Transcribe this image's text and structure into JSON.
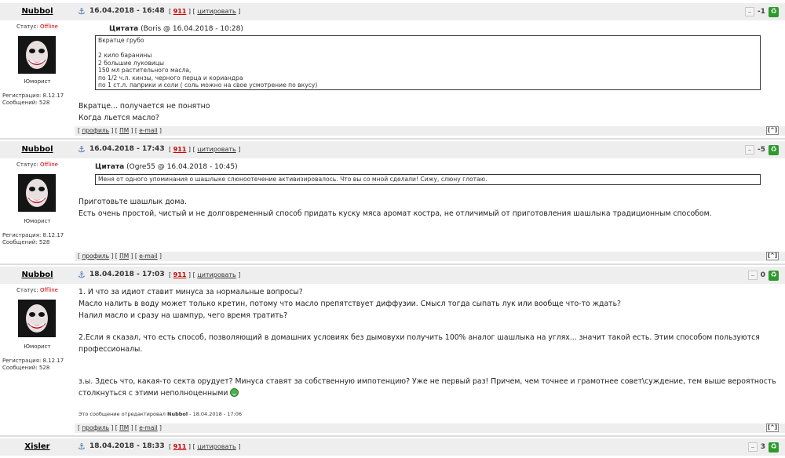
{
  "posts": [
    {
      "author": "Nubbol",
      "status_label": "Статус:",
      "status_value": "Offline",
      "rank": "Юморист",
      "reg_line": "Регистрация: 8.12.17",
      "msg_line": "Сообщений: 528",
      "date": "16.04.2018 - 16:48",
      "num": "911",
      "quote_label": "цитировать",
      "score": "-1",
      "quote_title_prefix": "Цитата",
      "quote_title_rest": " (Boris @ 16.04.2018 - 10:28)",
      "quote_lines": [
        "Вкратце грубо",
        "",
        "2 кило баранины",
        "2 большие луковицы",
        "150 мл растительного масла,",
        "по 1/2 ч.л. кинзы, черного перца и кориандра",
        "по 1 ст.л. паприки и соли ( соль можно на свое усмотрение по вкусу)"
      ],
      "body_lines": [
        "Вкратце... получается не понятно",
        "Когда льется масло?"
      ]
    },
    {
      "author": "Nubbol",
      "status_label": "Статус:",
      "status_value": "Offline",
      "rank": "Юморист",
      "reg_line": "Регистрация: 8.12.17",
      "msg_line": "Сообщений: 528",
      "date": "16.04.2018 - 17:43",
      "num": "911",
      "quote_label": "цитировать",
      "score": "-5",
      "quote_title_prefix": "Цитата",
      "quote_title_rest": " (Ogre55 @ 16.04.2018 - 10:45)",
      "quote_lines": [
        "Меня от одного упоминания о шашлыке слюноотечение активизировалось. Что вы со мной сделали! Сижу, слюну глотаю."
      ],
      "body_lines": [
        "Приготовьте шашлык дома.",
        "Есть очень простой, чистый и не долговременный способ придать куску мяса аромат костра, не отличимый от приготовления шашлыка традиционным способом."
      ]
    },
    {
      "author": "Nubbol",
      "status_label": "Статус:",
      "status_value": "Offline",
      "rank": "Юморист",
      "reg_line": "Регистрация: 8.12.17",
      "msg_line": "Сообщений: 528",
      "date": "18.04.2018 - 17:03",
      "num": "911",
      "quote_label": "цитировать",
      "score": "0",
      "body_lines": [
        "1. И что за идиот ставит минуса за нормальные вопросы?",
        "Масло налить в воду может только кретин, потому что масло препятствует диффузии. Смысл тогда сыпать лук или вообще что-то ждать?",
        "Налил масло и сразу на шампур, чего время тратить?",
        "",
        "2.Если я сказал, что есть способ, позволяющий в домашних условиях без дымовухи получить 100% аналог шашлыка на углях... значит такой есть. Этим способом пользуются",
        "профессионалы.",
        "",
        "",
        "з.ы. Здесь что, какая-то секта орудует? Минуса ставят за собственную импотенцию? Уже не первый раз! Причем, чем точнее и грамотнее совет\\суждение, тем выше вероятность",
        "столкнуться с этими неполноценными"
      ],
      "edit_prefix": "Это сообщение отредактировал ",
      "edit_author": "Nubbol",
      "edit_suffix": " - 18.04.2018 - 17:06"
    },
    {
      "author": "Xisler",
      "date": "18.04.2018 - 18:33",
      "num": "911",
      "quote_label": "цитировать",
      "score": "3"
    }
  ],
  "footer": {
    "profile": "профиль",
    "pm": "ПМ",
    "email": "e-mail",
    "top": "[^]"
  }
}
